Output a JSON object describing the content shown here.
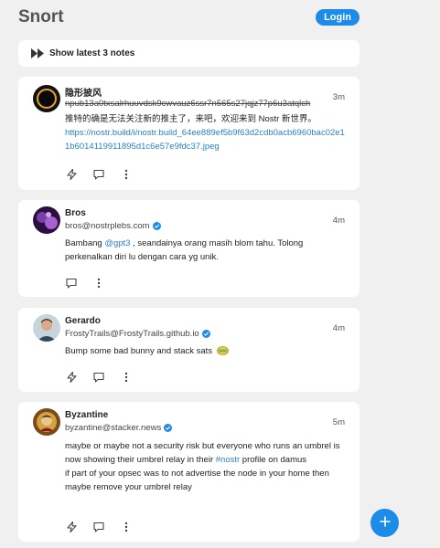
{
  "header": {
    "logo": "Snort",
    "login_label": "Login"
  },
  "show_latest": {
    "label": "Show latest 3 notes"
  },
  "notes": [
    {
      "name": "隐形披风",
      "nip": "npub13a0txsalrhuuvdsk9cwvauz6ssr7n565s27jqjz77p6u3atqlch",
      "time": "3m",
      "text": "推特的确是无法关注新的推主了，来吧，欢迎来到 Nostr 新世界。",
      "link": "https://nostr.build/i/nostr.build_64ee889ef5b9f63d2cdb0acb6960bac02e11b6014119911895d1c6e57e9fdc37.jpeg"
    },
    {
      "name": "Bros",
      "nip": "bros@nostrplebs.com",
      "time": "4m",
      "text_before": "Bambang ",
      "mention": "@gpt3",
      "text_after": " , seandainya orang masih blom tahu. Tolong perkenalkan diri lu dengan cara yg unik."
    },
    {
      "name": "Gerardo",
      "nip": "FrostyTrails@FrostyTrails.github.io",
      "time": "4m",
      "text": "Bump some bad bunny and stack sats"
    },
    {
      "name": "Byzantine",
      "nip": "byzantine@stacker.news",
      "time": "5m",
      "text_before": "maybe or maybe not a security risk but everyone who runs an umbrel is now showing their umbrel relay in their ",
      "hashtag": "#nostr",
      "text_after": " profile on damus",
      "text_line2": "if part of your opsec was to not advertise the node in your home then maybe remove your umbrel relay"
    }
  ],
  "icons": {
    "fast_forward": "fast-forward-icon",
    "zap": "zap-icon",
    "reply": "reply-icon",
    "more": "more-icon",
    "verified": "verified-icon",
    "plus": "plus-icon"
  },
  "colors": {
    "accent": "#1d8be8",
    "link": "#2a7fc5",
    "background": "#f0f0f0"
  }
}
